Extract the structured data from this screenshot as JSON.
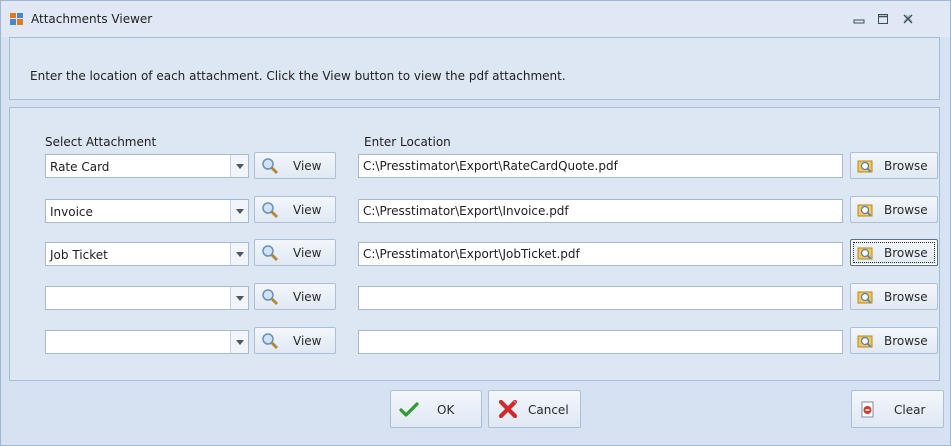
{
  "window": {
    "title": "Attachments Viewer"
  },
  "instructions": "Enter the location of each attachment.  Click the View button to view the pdf attachment.",
  "headers": {
    "select": "Select Attachment",
    "location": "Enter Location"
  },
  "rows": [
    {
      "selection": "Rate Card",
      "view_label": "View",
      "location": "C:\\Presstimator\\Export\\RateCardQuote.pdf",
      "browse_label": "Browse"
    },
    {
      "selection": "Invoice",
      "view_label": "View",
      "location": "C:\\Presstimator\\Export\\Invoice.pdf",
      "browse_label": "Browse"
    },
    {
      "selection": "Job Ticket",
      "view_label": "View",
      "location": "C:\\Presstimator\\Export\\JobTicket.pdf",
      "browse_label": "Browse"
    },
    {
      "selection": "",
      "view_label": "View",
      "location": "",
      "browse_label": "Browse"
    },
    {
      "selection": "",
      "view_label": "View",
      "location": "",
      "browse_label": "Browse"
    }
  ],
  "footer": {
    "ok_label": "OK",
    "cancel_label": "Cancel",
    "clear_label": "Clear"
  },
  "icons": {
    "app": "app-icon",
    "view": "magnifier-icon",
    "browse": "folder-browse-icon",
    "ok": "checkmark-icon",
    "cancel": "x-icon",
    "clear": "clear-document-icon"
  },
  "colors": {
    "accent": "#dde7f3",
    "border": "#a6bcd7",
    "ok_green": "#2e9b2e",
    "cancel_red": "#d02b2b"
  }
}
